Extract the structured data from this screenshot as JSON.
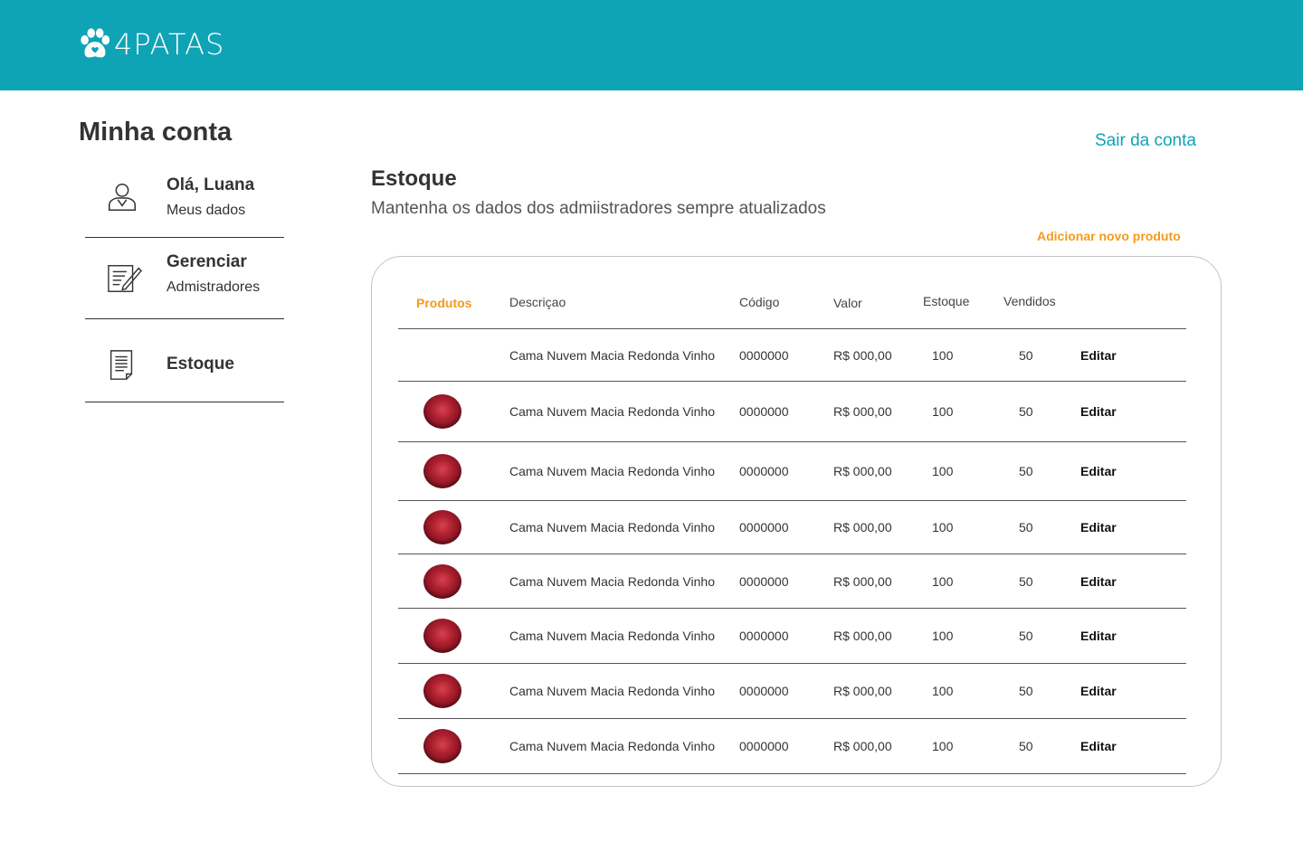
{
  "brand": {
    "name": "4PATAS",
    "color": "#0fa3b6",
    "accent": "#f39a1e"
  },
  "page_title": "Minha conta",
  "logout_label": "Sair da conta",
  "menu": [
    {
      "title": "Olá, Luana",
      "subtitle": "Meus dados",
      "icon": "user-icon"
    },
    {
      "title": "Gerenciar",
      "subtitle": "Admistradores",
      "icon": "edit-document-icon"
    },
    {
      "title": "Estoque",
      "subtitle": "",
      "icon": "document-icon"
    }
  ],
  "section": {
    "title": "Estoque",
    "subtitle": "Mantenha os dados dos admiistradores sempre atualizados",
    "add_label": "Adicionar novo produto"
  },
  "table": {
    "headers": [
      "Produtos",
      "Descriçao",
      "Código",
      "Valor",
      "Estoque",
      "Vendidos"
    ],
    "rows": [
      {
        "has_image": false,
        "desc": "Cama Nuvem Macia Redonda Vinho",
        "code": "0000000",
        "price": "R$ 000,00",
        "stock": "100",
        "sold": "50",
        "action": "Editar"
      },
      {
        "has_image": true,
        "desc": "Cama Nuvem Macia Redonda Vinho",
        "code": "0000000",
        "price": "R$ 000,00",
        "stock": "100",
        "sold": "50",
        "action": "Editar"
      },
      {
        "has_image": true,
        "desc": "Cama Nuvem Macia Redonda Vinho",
        "code": "0000000",
        "price": "R$ 000,00",
        "stock": "100",
        "sold": "50",
        "action": "Editar"
      },
      {
        "has_image": true,
        "desc": "Cama Nuvem Macia Redonda Vinho",
        "code": "0000000",
        "price": "R$ 000,00",
        "stock": "100",
        "sold": "50",
        "action": "Editar"
      },
      {
        "has_image": true,
        "desc": "Cama Nuvem Macia Redonda Vinho",
        "code": "0000000",
        "price": "R$ 000,00",
        "stock": "100",
        "sold": "50",
        "action": "Editar"
      },
      {
        "has_image": true,
        "desc": "Cama Nuvem Macia Redonda Vinho",
        "code": "0000000",
        "price": "R$ 000,00",
        "stock": "100",
        "sold": "50",
        "action": "Editar"
      },
      {
        "has_image": true,
        "desc": "Cama Nuvem Macia Redonda Vinho",
        "code": "0000000",
        "price": "R$ 000,00",
        "stock": "100",
        "sold": "50",
        "action": "Editar"
      },
      {
        "has_image": true,
        "desc": "Cama Nuvem Macia Redonda Vinho",
        "code": "0000000",
        "price": "R$ 000,00",
        "stock": "100",
        "sold": "50",
        "action": "Editar"
      }
    ]
  }
}
